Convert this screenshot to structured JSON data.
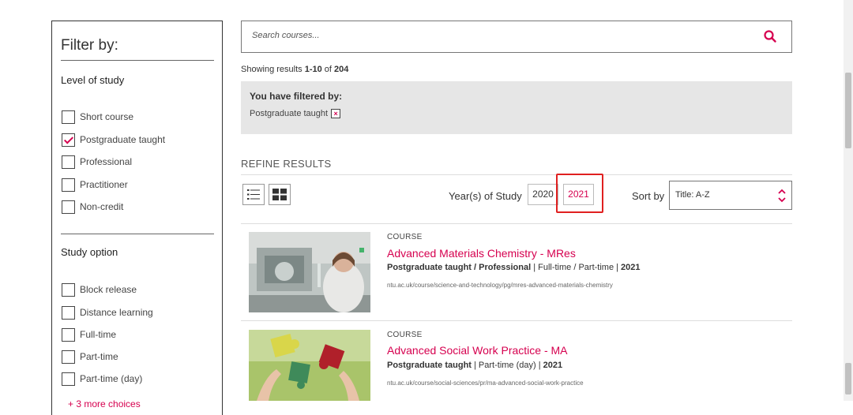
{
  "sidebar": {
    "title": "Filter by:",
    "level_title": "Level of study",
    "level_options": [
      {
        "label": "Short course",
        "checked": false
      },
      {
        "label": "Postgraduate taught",
        "checked": true
      },
      {
        "label": "Professional",
        "checked": false
      },
      {
        "label": "Practitioner",
        "checked": false
      },
      {
        "label": "Non-credit",
        "checked": false
      }
    ],
    "study_title": "Study option",
    "study_options": [
      {
        "label": "Block release",
        "checked": false
      },
      {
        "label": "Distance learning",
        "checked": false
      },
      {
        "label": "Full-time",
        "checked": false
      },
      {
        "label": "Part-time",
        "checked": false
      },
      {
        "label": "Part-time (day)",
        "checked": false
      }
    ],
    "more_link": "+ 3 more choices"
  },
  "search": {
    "placeholder": "Search courses...",
    "icon": "search-icon"
  },
  "results": {
    "prefix": "Showing results ",
    "range": "1-10",
    "of": " of ",
    "total": "204"
  },
  "filtered": {
    "title": "You have filtered by:",
    "chip": "Postgraduate taught",
    "remove": "×"
  },
  "refine": {
    "heading": "REFINE RESULTS",
    "year_label": "Year(s) of Study",
    "years": [
      "2020",
      "2021"
    ],
    "active_year": "2021",
    "sort_label": "Sort by",
    "sort_value": "Title: A-Z"
  },
  "courses": [
    {
      "type": "COURSE",
      "title": "Advanced Materials Chemistry - MRes",
      "meta_bold": "Postgraduate taught / Professional",
      "meta_rest": " | Full-time / Part-time | ",
      "year": "2021",
      "url": "ntu.ac.uk/course/science-and-technology/pg/mres-advanced-materials-chemistry"
    },
    {
      "type": "COURSE",
      "title": "Advanced Social Work Practice - MA",
      "meta_bold": "Postgraduate taught",
      "meta_rest": " | Part-time (day) | ",
      "year": "2021",
      "url": "ntu.ac.uk/course/social-sciences/pr/ma-advanced-social-work-practice"
    }
  ],
  "colors": {
    "accent": "#d6004f",
    "highlight": "#e02020",
    "panel": "#e6e6e6"
  }
}
